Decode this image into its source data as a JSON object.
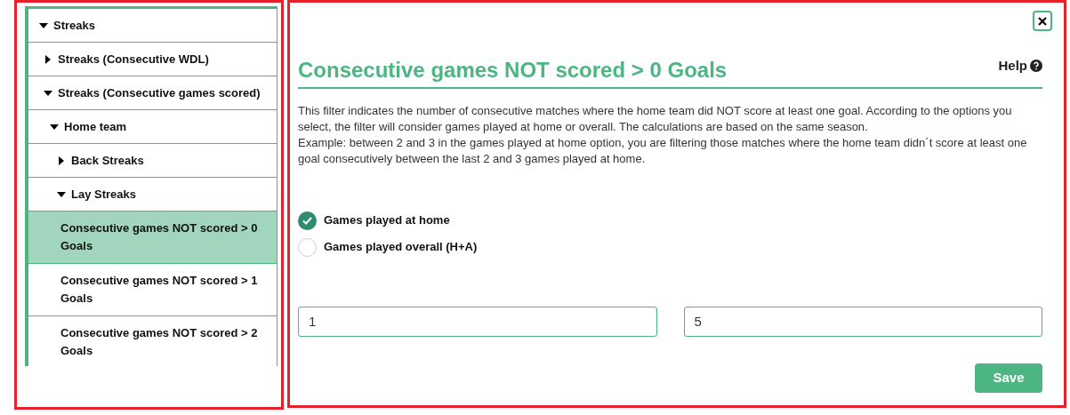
{
  "tree": [
    {
      "label": "Streaks",
      "expanded": true,
      "selected": false,
      "children": [
        {
          "label": "Streaks (Consecutive WDL)",
          "expanded": false,
          "selected": false
        },
        {
          "label": "Streaks (Consecutive games scored)",
          "expanded": true,
          "selected": false,
          "children": [
            {
              "label": "Home team",
              "expanded": true,
              "selected": false,
              "children": [
                {
                  "label": "Back Streaks",
                  "expanded": false,
                  "selected": false
                },
                {
                  "label": "Lay Streaks",
                  "expanded": true,
                  "selected": false,
                  "children": [
                    {
                      "label": "Consecutive games NOT scored > 0 Goals",
                      "selected": true
                    },
                    {
                      "label": "Consecutive games NOT scored > 1 Goals",
                      "selected": false
                    },
                    {
                      "label": "Consecutive games NOT scored > 2 Goals",
                      "selected": false
                    }
                  ]
                }
              ]
            }
          ]
        }
      ]
    }
  ],
  "dialog": {
    "title": "Consecutive games NOT scored > 0 Goals",
    "help": "Help",
    "description": [
      "This filter indicates the number of consecutive matches where the home team did NOT score at least one goal. According to the options you select, the filter will consider games played at home or overall. The calculations are based on the same season.",
      "Example: between 2 and 3 in the games played at home option, you are filtering those matches where the home team didn´t score at least one goal consecutively between the last 2 and 3 games played at home."
    ],
    "options": [
      {
        "label": "Games played at home",
        "selected": true
      },
      {
        "label": "Games played overall (H+A)",
        "selected": false
      }
    ],
    "min_value": "1",
    "max_value": "5",
    "save": "Save"
  }
}
